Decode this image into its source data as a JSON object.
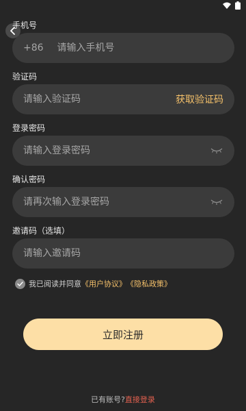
{
  "colors": {
    "background": "#262626",
    "input_background": "#3b3b3b",
    "accent": "#f4c06a",
    "primary_button": "#fddfa6",
    "login_link": "#e0604f"
  },
  "status_bar": {
    "icons": [
      "wifi-icon",
      "battery-icon"
    ]
  },
  "phone": {
    "label": "手机号",
    "country_code": "+86",
    "placeholder": "请输入手机号"
  },
  "verification": {
    "label": "验证码",
    "placeholder": "请输入验证码",
    "get_code_label": "获取验证码"
  },
  "password": {
    "label": "登录密码",
    "placeholder": "请输入登录密码"
  },
  "confirm_password": {
    "label": "确认密码",
    "placeholder": "请再次输入登录密码"
  },
  "invite": {
    "label": "邀请码（选填）",
    "placeholder": "请输入邀请码"
  },
  "agreement": {
    "checked": true,
    "prefix": "我已阅读并同意",
    "user_agreement": "《用户协议》",
    "privacy_policy": "《隐私政策》"
  },
  "register_button_label": "立即注册",
  "footer": {
    "prompt": "已有账号?",
    "login_link": "直接登录"
  }
}
